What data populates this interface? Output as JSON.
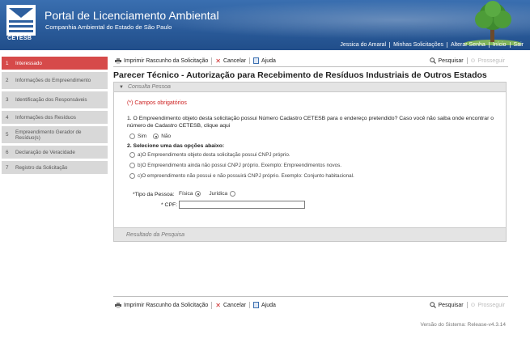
{
  "header": {
    "title": "Portal de Licenciamento Ambiental",
    "subtitle": "Companhia Ambiental do Estado de São Paulo",
    "logo_text": "CETESB",
    "nav": [
      "Jessica do Amaral",
      "Minhas Solicitações",
      "Alterar Senha",
      "Início",
      "Sair"
    ]
  },
  "sidebar": {
    "items": [
      {
        "num": "1",
        "label": "Interessado",
        "active": true
      },
      {
        "num": "2",
        "label": "Informações do Empreendimento"
      },
      {
        "num": "3",
        "label": "Identificação dos Responsáveis"
      },
      {
        "num": "4",
        "label": "Informações dos Resíduos"
      },
      {
        "num": "5",
        "label": "Empreendimento Gerador de Resíduo(s)"
      },
      {
        "num": "6",
        "label": "Declaração de Veracidade"
      },
      {
        "num": "7",
        "label": "Registro da Solicitação"
      }
    ]
  },
  "toolbar": {
    "print_label": "Imprimir Rascunho da Solicitação",
    "cancel_label": "Cancelar",
    "help_label": "Ajuda",
    "search_label": "Pesquisar",
    "next_label": "Prosseguir"
  },
  "page_title": "Parecer Técnico - Autorização para Recebimento de Resíduos Industriais de Outros Estados",
  "panel": {
    "header": "Consulta Pessoa",
    "footer": "Resultado da Pesquisa",
    "required_note": "(*) Campos obrigatórios",
    "q1": "1. O Empreendimento objeto desta solicitação possui Número Cadastro CETESB para o endereço pretendido? Caso você não saiba onde encontrar o número de Cadastro CETESB, clique aqui",
    "q1_yes": "Sim",
    "q1_no": "Não",
    "q2": "2. Selecione uma das opções abaixo:",
    "options": [
      "a)O Empreendimento objeto desta solicitação possui CNPJ próprio.",
      "b)O Empreendimento ainda não possui CNPJ próprio. Exemplo: Empreendimentos novos.",
      "c)O empreendimento não possui e não possuirá CNPJ próprio. Exemplo: Conjunto habitacional."
    ],
    "person_type_label": "*Tipo da Pessoa:",
    "person_fisica": "Física",
    "person_juridica": "Jurídica",
    "cpf_label": "* CPF:",
    "cpf_value": ""
  },
  "version": "Versão do Sistema: Release-v4.3.14"
}
